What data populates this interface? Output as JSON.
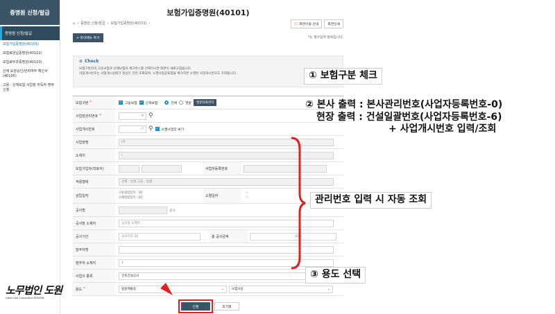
{
  "sidebar": {
    "title": "증명원 신청/발급",
    "active": "증명원 신청/발급",
    "items": [
      "보험가입증명원(40101)",
      "보험료완납증명원(40102)",
      "보험료부과증명원(40103)",
      "산재 요양승인/반려여부 확인서(40105)",
      "고용 · 산재보험 사업장 취득자 명부 신청"
    ]
  },
  "header": {
    "title": "보험가입증명원(40101)",
    "breadcrumb": [
      "증명원 신청/발급",
      "보험가입증명원(40101)"
    ],
    "screen_guide": "화면이용 안내",
    "print": "화면인쇄",
    "favorite": "+ 마이메뉴 추가",
    "required_note": "는 필수입력 항목입니다."
  },
  "check": {
    "title": "Check",
    "lines": [
      "보험구분란의 고용보험과 산재보험의 체크박스를 선택하시면 화면이 새로고침됩니다.",
      "사업개시번호는 사업개시상태가 정상인 건만 조회되며, 소멸사업장포함을 체크하면 소멸된 사업개시번호도 조회됩니다."
    ]
  },
  "form": {
    "insurance_type": {
      "label": "보험구분",
      "opt1": "고용보험",
      "opt2": "산재보험",
      "opt3": "전체",
      "opt4": "영문",
      "mgmt_button": "영문자료관리"
    },
    "mgmt_no": {
      "label": "사업장관리번호",
      "value": "-0"
    },
    "start_no": {
      "label": "사업개시번호",
      "value": "-7",
      "check": "소멸사업장 보기"
    },
    "site_name": {
      "label": "사업장명",
      "value": "(주"
    },
    "address": {
      "label": "소재지",
      "value": "("
    },
    "policy_holder": {
      "label": "보험가입자(대표자)",
      "biz_label": "사업자등록번호"
    },
    "work_type": {
      "label": "적용형태",
      "value": "산재 : 일괄  고용 : 일괄"
    },
    "est_date": {
      "label": "성립일자",
      "line1": "고용성립일자 : 20",
      "line2": "산재성립일자 : 20",
      "end_label": "소멸일자",
      "end1": "--",
      "end2": "--"
    },
    "project_name": {
      "label": "공사명",
      "suffix": "공사"
    },
    "project_addr": {
      "label": "공사장 소재지",
      "value": "공사장 소재지"
    },
    "period": {
      "label": "공사기간",
      "value": "공사기간 20",
      "amount_label": "총 공사금액",
      "amount_value": ",000"
    },
    "orderer": {
      "label": "발주자명"
    },
    "orderer_addr": {
      "label": "발주자 소재지",
      "value": "1"
    },
    "business_kind": {
      "label": "사업의 종류",
      "value": "건축건설공사"
    },
    "usage": {
      "label": "용도",
      "value": "법원제출용",
      "value2": "보험사용"
    }
  },
  "buttons": {
    "apply": "신청",
    "reset": "초기화"
  },
  "notes": {
    "n1": "① 보험구분 체크",
    "n2_l1": "② 본사 출력 : 본사관리번호(사업자등록번호-0)",
    "n2_l2": "현장 출력 : 건설일괄번호(사업자등록번호-6)",
    "n2_l3": "+ 사업개시번호 입력/조회",
    "n_auto": "관리번호 입력 시 자동 조회",
    "n3": "③ 용도 선택"
  },
  "logo": {
    "main": "노무법인 도원",
    "sub": "Labor Law Corporation DOWON"
  },
  "colors": {
    "navy": "#3b5466",
    "accent": "#1c8ccf",
    "red": "#e02020"
  }
}
